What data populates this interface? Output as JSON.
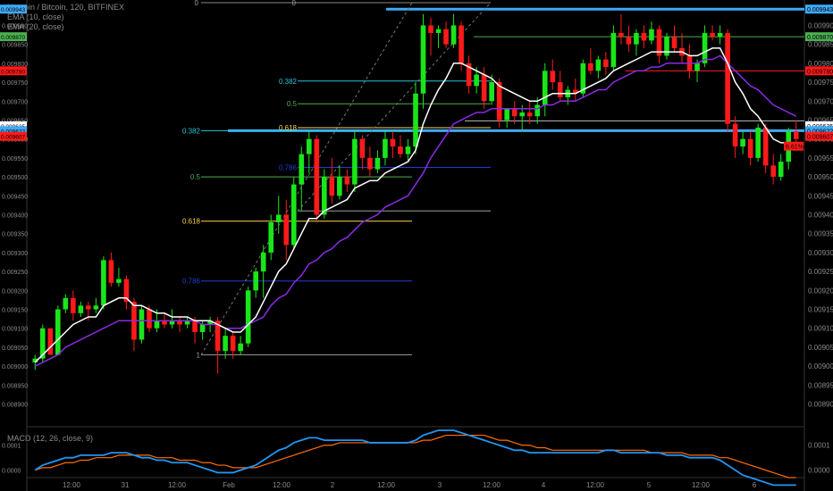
{
  "header": {
    "symbol_line": "Litecoin / Bitcoin, 120, BITFINEX",
    "ema10_line": "EMA (10, close)",
    "ema20_line": "EMA (20, close)",
    "macd_line": "MACD (12, 26, close, 9)"
  },
  "colors": {
    "background": "#000000",
    "up": "#19e619",
    "down": "#ff1a1a",
    "ema10": "#ffffff",
    "ema20": "#8a2be2",
    "macd": "#2196f3",
    "signal": "#ff6d00",
    "resistance": "#3fa9f5",
    "fib_0382": "#26c6da",
    "fib_05": "#4caf50",
    "fib_0618": "#ffd54f",
    "fib_0786": "#1e3fd8",
    "fib_1": "#9e9e9e",
    "fib_0": "#9e9e9e"
  },
  "chart_data": {
    "type": "candlestick",
    "title": "Litecoin / Bitcoin, 120, BITFINEX",
    "ylim": [
      0.00884,
      0.00996
    ],
    "y_ticks": [
      "0.009900",
      "0.009850",
      "0.009800",
      "0.009750",
      "0.009700",
      "0.009650",
      "0.009600",
      "0.009550",
      "0.009500",
      "0.009450",
      "0.009400",
      "0.009350",
      "0.009300",
      "0.009250",
      "0.009200",
      "0.009150",
      "0.009100",
      "0.009050",
      "0.009000",
      "0.008950",
      "0.008900"
    ],
    "x_labels": [
      "12:00",
      "31",
      "12:00",
      "Feb",
      "12:00",
      "2",
      "12:00",
      "3",
      "12:00",
      "4",
      "12:00",
      "5",
      "12:00",
      "6"
    ],
    "candles": [
      [
        0.00901,
        0.00903,
        0.00899,
        0.00902
      ],
      [
        0.00902,
        0.00911,
        0.00901,
        0.0091
      ],
      [
        0.0091,
        0.00906,
        0.00904,
        0.00903
      ],
      [
        0.00903,
        0.00916,
        0.00903,
        0.00915
      ],
      [
        0.00915,
        0.00919,
        0.00914,
        0.00918
      ],
      [
        0.00918,
        0.0092,
        0.00912,
        0.00914
      ],
      [
        0.00914,
        0.00917,
        0.00913,
        0.00916
      ],
      [
        0.00916,
        0.00917,
        0.00912,
        0.00915
      ],
      [
        0.00915,
        0.00918,
        0.00914,
        0.00916
      ],
      [
        0.00916,
        0.00929,
        0.00915,
        0.00928
      ],
      [
        0.00928,
        0.0093,
        0.00921,
        0.00922
      ],
      [
        0.00922,
        0.00926,
        0.00921,
        0.00923
      ],
      [
        0.00923,
        0.00924,
        0.00915,
        0.00917
      ],
      [
        0.00917,
        0.00918,
        0.00904,
        0.00907
      ],
      [
        0.00907,
        0.00916,
        0.00906,
        0.00915
      ],
      [
        0.00915,
        0.00916,
        0.00909,
        0.0091
      ],
      [
        0.0091,
        0.00915,
        0.00909,
        0.00912
      ],
      [
        0.00912,
        0.00914,
        0.0091,
        0.00911
      ],
      [
        0.00911,
        0.00915,
        0.0091,
        0.00912
      ],
      [
        0.00912,
        0.00913,
        0.00909,
        0.00911
      ],
      [
        0.00911,
        0.00913,
        0.0091,
        0.00912
      ],
      [
        0.00912,
        0.00913,
        0.00906,
        0.00909
      ],
      [
        0.00909,
        0.00912,
        0.00907,
        0.00911
      ],
      [
        0.00911,
        0.00913,
        0.00909,
        0.00912
      ],
      [
        0.00912,
        0.00913,
        0.00898,
        0.00904
      ],
      [
        0.00904,
        0.0091,
        0.00902,
        0.00908
      ],
      [
        0.00908,
        0.00909,
        0.00902,
        0.00904
      ],
      [
        0.00904,
        0.00908,
        0.00903,
        0.00906
      ],
      [
        0.00906,
        0.00921,
        0.00905,
        0.0092
      ],
      [
        0.0092,
        0.00926,
        0.00918,
        0.00925
      ],
      [
        0.00925,
        0.00932,
        0.00918,
        0.0093
      ],
      [
        0.0093,
        0.0094,
        0.00928,
        0.00938
      ],
      [
        0.00938,
        0.00945,
        0.00935,
        0.0094
      ],
      [
        0.0094,
        0.00944,
        0.00928,
        0.00932
      ],
      [
        0.00932,
        0.0095,
        0.00931,
        0.00948
      ],
      [
        0.00948,
        0.00958,
        0.00941,
        0.00956
      ],
      [
        0.00956,
        0.00962,
        0.00951,
        0.0096
      ],
      [
        0.0096,
        0.00961,
        0.00938,
        0.0094
      ],
      [
        0.0094,
        0.00952,
        0.00939,
        0.0095
      ],
      [
        0.0095,
        0.00955,
        0.00943,
        0.00945
      ],
      [
        0.00945,
        0.00953,
        0.00944,
        0.0095
      ],
      [
        0.0095,
        0.00952,
        0.00946,
        0.00948
      ],
      [
        0.00948,
        0.00962,
        0.00946,
        0.0096
      ],
      [
        0.0096,
        0.00961,
        0.00952,
        0.00955
      ],
      [
        0.00955,
        0.00958,
        0.0095,
        0.00952
      ],
      [
        0.00952,
        0.00957,
        0.00951,
        0.00955
      ],
      [
        0.00955,
        0.00962,
        0.00953,
        0.0096
      ],
      [
        0.0096,
        0.00962,
        0.00955,
        0.00958
      ],
      [
        0.00958,
        0.00961,
        0.00955,
        0.00956
      ],
      [
        0.00956,
        0.0096,
        0.00954,
        0.00958
      ],
      [
        0.00958,
        0.00975,
        0.00956,
        0.00972
      ],
      [
        0.00972,
        0.00993,
        0.00968,
        0.0099
      ],
      [
        0.0099,
        0.00992,
        0.00982,
        0.00988
      ],
      [
        0.00988,
        0.0099,
        0.00984,
        0.00989
      ],
      [
        0.00989,
        0.00991,
        0.00984,
        0.00985
      ],
      [
        0.00985,
        0.00993,
        0.00984,
        0.0099
      ],
      [
        0.0099,
        0.00991,
        0.00978,
        0.0098
      ],
      [
        0.0098,
        0.00982,
        0.00972,
        0.00974
      ],
      [
        0.00974,
        0.00979,
        0.00972,
        0.00977
      ],
      [
        0.00977,
        0.00979,
        0.00968,
        0.0097
      ],
      [
        0.0097,
        0.00977,
        0.00969,
        0.00975
      ],
      [
        0.00975,
        0.00976,
        0.00963,
        0.00965
      ],
      [
        0.00965,
        0.00968,
        0.00963,
        0.00968
      ],
      [
        0.00968,
        0.0097,
        0.00964,
        0.00966
      ],
      [
        0.00966,
        0.00969,
        0.00962,
        0.00967
      ],
      [
        0.00967,
        0.0097,
        0.00964,
        0.00966
      ],
      [
        0.00966,
        0.00971,
        0.00964,
        0.00969
      ],
      [
        0.00969,
        0.0098,
        0.00966,
        0.00978
      ],
      [
        0.00978,
        0.00981,
        0.00973,
        0.00975
      ],
      [
        0.00975,
        0.00978,
        0.0097,
        0.00971
      ],
      [
        0.00971,
        0.00974,
        0.00969,
        0.00973
      ],
      [
        0.00973,
        0.00976,
        0.0097,
        0.00972
      ],
      [
        0.00972,
        0.00981,
        0.00971,
        0.0098
      ],
      [
        0.0098,
        0.00984,
        0.00977,
        0.00978
      ],
      [
        0.00978,
        0.00982,
        0.00976,
        0.00981
      ],
      [
        0.00981,
        0.00983,
        0.00977,
        0.00979
      ],
      [
        0.00979,
        0.0099,
        0.00978,
        0.00988
      ],
      [
        0.00988,
        0.00993,
        0.00985,
        0.00987
      ],
      [
        0.00987,
        0.0099,
        0.00983,
        0.00985
      ],
      [
        0.00985,
        0.00989,
        0.00982,
        0.00988
      ],
      [
        0.00988,
        0.0099,
        0.00984,
        0.00986
      ],
      [
        0.00986,
        0.00991,
        0.00985,
        0.00989
      ],
      [
        0.00989,
        0.0099,
        0.0098,
        0.00982
      ],
      [
        0.00982,
        0.00988,
        0.00981,
        0.00987
      ],
      [
        0.00987,
        0.0099,
        0.00983,
        0.00984
      ],
      [
        0.00984,
        0.00988,
        0.0098,
        0.00982
      ],
      [
        0.00982,
        0.00985,
        0.00976,
        0.00978
      ],
      [
        0.00978,
        0.00981,
        0.00975,
        0.0098
      ],
      [
        0.0098,
        0.0099,
        0.00979,
        0.00988
      ],
      [
        0.00988,
        0.0099,
        0.00986,
        0.00987
      ],
      [
        0.00987,
        0.0099,
        0.00985,
        0.00988
      ],
      [
        0.00988,
        0.00989,
        0.00962,
        0.00964
      ],
      [
        0.00964,
        0.00966,
        0.00955,
        0.00958
      ],
      [
        0.00958,
        0.00962,
        0.00956,
        0.0096
      ],
      [
        0.0096,
        0.00962,
        0.00953,
        0.00955
      ],
      [
        0.00955,
        0.00964,
        0.00954,
        0.00963
      ],
      [
        0.00963,
        0.00964,
        0.00951,
        0.00953
      ],
      [
        0.00953,
        0.00956,
        0.00948,
        0.0095
      ],
      [
        0.0095,
        0.00956,
        0.00949,
        0.00954
      ],
      [
        0.00954,
        0.00963,
        0.00952,
        0.00962
      ],
      [
        0.00962,
        0.00965,
        0.00958,
        0.0096
      ]
    ],
    "ema10": [
      0.00901,
      0.00903,
      0.00905,
      0.00907,
      0.00909,
      0.00911,
      0.00912,
      0.00913,
      0.00913,
      0.00916,
      0.00917,
      0.00918,
      0.00918,
      0.00916,
      0.00916,
      0.00915,
      0.00914,
      0.00914,
      0.00913,
      0.00913,
      0.00913,
      0.00912,
      0.00912,
      0.00912,
      0.00911,
      0.0091,
      0.00909,
      0.00909,
      0.00911,
      0.00913,
      0.00917,
      0.00921,
      0.00925,
      0.00927,
      0.00931,
      0.00935,
      0.00939,
      0.00939,
      0.00941,
      0.00942,
      0.00943,
      0.00944,
      0.00947,
      0.00948,
      0.00949,
      0.00949,
      0.00951,
      0.00952,
      0.00953,
      0.00954,
      0.00957,
      0.00964,
      0.00969,
      0.00973,
      0.00976,
      0.0098,
      0.0098,
      0.00979,
      0.00978,
      0.00977,
      0.00976,
      0.00974,
      0.00973,
      0.00972,
      0.00971,
      0.0097,
      0.0097,
      0.00971,
      0.00972,
      0.00972,
      0.00972,
      0.00972,
      0.00973,
      0.00974,
      0.00975,
      0.00976,
      0.00978,
      0.00979,
      0.0098,
      0.00981,
      0.00982,
      0.00983,
      0.00983,
      0.00983,
      0.00983,
      0.00983,
      0.00982,
      0.00982,
      0.00983,
      0.00984,
      0.00984,
      0.0098,
      0.00975,
      0.00972,
      0.00968,
      0.00966,
      0.00963,
      0.0096,
      0.00959,
      0.00959,
      0.00959
    ],
    "ema20": [
      0.009,
      0.00901,
      0.00902,
      0.00903,
      0.00905,
      0.00906,
      0.00907,
      0.00908,
      0.00909,
      0.0091,
      0.00911,
      0.00912,
      0.00912,
      0.00912,
      0.00912,
      0.00912,
      0.00912,
      0.00912,
      0.00912,
      0.00912,
      0.00912,
      0.00912,
      0.00911,
      0.00911,
      0.00911,
      0.0091,
      0.0091,
      0.0091,
      0.00911,
      0.00912,
      0.00913,
      0.00916,
      0.00918,
      0.00919,
      0.00922,
      0.00924,
      0.00927,
      0.00928,
      0.0093,
      0.00931,
      0.00933,
      0.00934,
      0.00936,
      0.00938,
      0.00939,
      0.0094,
      0.00942,
      0.00943,
      0.00944,
      0.00945,
      0.00948,
      0.00951,
      0.00955,
      0.00958,
      0.00961,
      0.00964,
      0.00965,
      0.00966,
      0.00967,
      0.00967,
      0.00968,
      0.00968,
      0.00968,
      0.00968,
      0.00968,
      0.00968,
      0.00968,
      0.00969,
      0.00969,
      0.0097,
      0.0097,
      0.0097,
      0.00971,
      0.00972,
      0.00973,
      0.00973,
      0.00975,
      0.00976,
      0.00977,
      0.00978,
      0.00978,
      0.00979,
      0.00979,
      0.0098,
      0.0098,
      0.0098,
      0.0098,
      0.0098,
      0.00981,
      0.00981,
      0.00982,
      0.0098,
      0.00978,
      0.00976,
      0.00974,
      0.00973,
      0.00971,
      0.00969,
      0.00968,
      0.00967,
      0.00966
    ],
    "macd": [
      0.0,
      2e-05,
      3e-05,
      4e-05,
      5e-05,
      5e-05,
      6e-05,
      6e-05,
      6e-05,
      6e-05,
      7e-05,
      7e-05,
      7e-05,
      6e-05,
      5e-05,
      5e-05,
      4e-05,
      4e-05,
      3e-05,
      3e-05,
      3e-05,
      2e-05,
      1e-05,
      0.0,
      -1e-05,
      -1e-05,
      -1e-05,
      0.0,
      1e-05,
      2e-05,
      4e-05,
      6e-05,
      8e-05,
      9e-05,
      0.00011,
      0.00012,
      0.00013,
      0.00013,
      0.00012,
      0.00012,
      0.00012,
      0.00012,
      0.00012,
      0.00012,
      0.00011,
      0.00011,
      0.00011,
      0.00011,
      0.00011,
      0.00011,
      0.00012,
      0.00014,
      0.00015,
      0.00016,
      0.00016,
      0.00016,
      0.00015,
      0.00014,
      0.00013,
      0.00012,
      0.00011,
      0.0001,
      9e-05,
      8e-05,
      8e-05,
      7e-05,
      7e-05,
      7e-05,
      7e-05,
      7e-05,
      7e-05,
      7e-05,
      7e-05,
      7e-05,
      7e-05,
      8e-05,
      8e-05,
      7e-05,
      7e-05,
      7e-05,
      7e-05,
      7e-05,
      7e-05,
      6e-05,
      6e-05,
      6e-05,
      5e-05,
      5e-05,
      5e-05,
      5e-05,
      4e-05,
      2e-05,
      0.0,
      -2e-05,
      -3e-05,
      -4e-05,
      -5e-05,
      -6e-05,
      -6e-05,
      -6e-05,
      -6e-05
    ],
    "signal": [
      0.0,
      1e-05,
      1e-05,
      2e-05,
      3e-05,
      3e-05,
      4e-05,
      4e-05,
      5e-05,
      5e-05,
      5e-05,
      6e-05,
      6e-05,
      6e-05,
      6e-05,
      6e-05,
      5e-05,
      5e-05,
      5e-05,
      4e-05,
      4e-05,
      4e-05,
      3e-05,
      3e-05,
      2e-05,
      2e-05,
      1e-05,
      1e-05,
      1e-05,
      1e-05,
      2e-05,
      3e-05,
      4e-05,
      5e-05,
      6e-05,
      7e-05,
      8e-05,
      9e-05,
      0.0001,
      0.0001,
      0.00011,
      0.00011,
      0.00011,
      0.00011,
      0.00011,
      0.00011,
      0.00011,
      0.00011,
      0.00011,
      0.00011,
      0.00011,
      0.00012,
      0.00012,
      0.00013,
      0.00014,
      0.00014,
      0.00014,
      0.00014,
      0.00014,
      0.00014,
      0.00013,
      0.00012,
      0.00012,
      0.00011,
      0.0001,
      0.0001,
      9e-05,
      9e-05,
      8e-05,
      8e-05,
      8e-05,
      8e-05,
      8e-05,
      8e-05,
      8e-05,
      8e-05,
      8e-05,
      8e-05,
      8e-05,
      8e-05,
      8e-05,
      7e-05,
      7e-05,
      7e-05,
      7e-05,
      7e-05,
      6e-05,
      6e-05,
      6e-05,
      6e-05,
      5e-05,
      5e-05,
      4e-05,
      3e-05,
      2e-05,
      1e-05,
      0.0,
      -1e-05,
      -2e-05,
      -3e-05,
      -3e-05
    ],
    "macd_ylim": [
      -3e-05,
      0.00016
    ],
    "macd_ticks": [
      "0.0001",
      "0.0000"
    ],
    "resistance_levels": [
      0.009943,
      0.009622
    ],
    "fib_levels_left": [
      {
        "label": "0.382",
        "value": 0.009622
      },
      {
        "label": "0.5",
        "value": 0.0095
      },
      {
        "label": "0.618",
        "value": 0.009383
      },
      {
        "label": "0.786",
        "value": 0.009225
      },
      {
        "label": "1",
        "value": 0.00903
      }
    ],
    "fib_levels_right": [
      {
        "label": "0.382",
        "value": 0.009753
      },
      {
        "label": "0.5",
        "value": 0.009693
      },
      {
        "label": "0.618",
        "value": 0.00963
      },
      {
        "label": "0.786",
        "value": 0.009525
      },
      {
        "label": "1",
        "value": 0.00941
      }
    ],
    "fib_zero_labels": [
      "0",
      "0"
    ],
    "price_tags": [
      {
        "text": "0.009943",
        "value": 0.009943,
        "color": "#3fa9f5"
      },
      {
        "text": "0.009870",
        "value": 0.00987,
        "color": "#4caf50"
      },
      {
        "text": "0.009780",
        "value": 0.00978,
        "color": "#ff1a1a"
      },
      {
        "text": "0.009635",
        "value": 0.009635,
        "color": "#ffffff"
      },
      {
        "text": "0.009622",
        "value": 0.009622,
        "color": "#3fa9f5"
      },
      {
        "text": "0.009607",
        "value": 0.009607,
        "color": "#ff1a1a"
      }
    ],
    "left_tags": [
      {
        "text": "0.009943",
        "value": 0.009943,
        "color": "#3fa9f5"
      },
      {
        "text": "0.009870",
        "value": 0.00987,
        "color": "#4caf50"
      },
      {
        "text": "0.009780",
        "value": 0.00978,
        "color": "#ff1a1a"
      },
      {
        "text": "0.009635",
        "value": 0.009635,
        "color": "#ffffff"
      },
      {
        "text": "0.009622",
        "value": 0.009622,
        "color": "#3fa9f5"
      },
      {
        "text": "0.009607",
        "value": 0.009607,
        "color": "#ff1a1a"
      }
    ],
    "fib_tag": {
      "text": "6.61%",
      "value": 0.009607
    },
    "green_level": 0.00987,
    "red_level": 0.00978
  }
}
